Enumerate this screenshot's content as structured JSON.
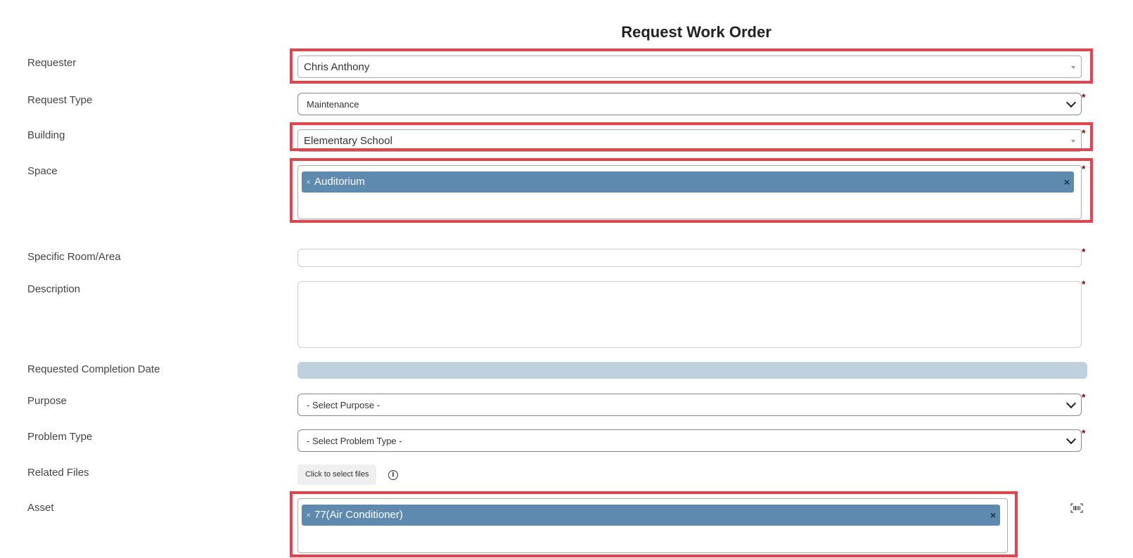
{
  "page": {
    "title": "Request Work Order"
  },
  "form": {
    "requester": {
      "label": "Requester",
      "value": "Chris Anthony"
    },
    "request_type": {
      "label": "Request Type",
      "value": "Maintenance"
    },
    "building": {
      "label": "Building",
      "value": "Elementary School"
    },
    "space": {
      "label": "Space",
      "chips": [
        "Auditorium"
      ]
    },
    "specific_room": {
      "label": "Specific Room/Area",
      "value": ""
    },
    "description": {
      "label": "Description",
      "value": ""
    },
    "requested_completion_date": {
      "label": "Requested Completion Date",
      "value": ""
    },
    "purpose": {
      "label": "Purpose",
      "value": "- Select Purpose -"
    },
    "problem_type": {
      "label": "Problem Type",
      "value": "- Select Problem Type -"
    },
    "related_files": {
      "label": "Related Files",
      "button_label": "Click to select files",
      "info_glyph": "i"
    },
    "asset": {
      "label": "Asset",
      "chips": [
        "77(Air Conditioner)"
      ]
    },
    "required_marker": "*",
    "remove_glyph": "×"
  },
  "icons": {
    "dropdown": "caret-down-icon",
    "info": "info-icon",
    "barcode": "barcode-scan-icon"
  },
  "colors": {
    "chip_background": "#5f8aaf",
    "highlight_border": "#e5434b",
    "required_marker": "#8b0000",
    "date_bar": "#bfd0de"
  }
}
